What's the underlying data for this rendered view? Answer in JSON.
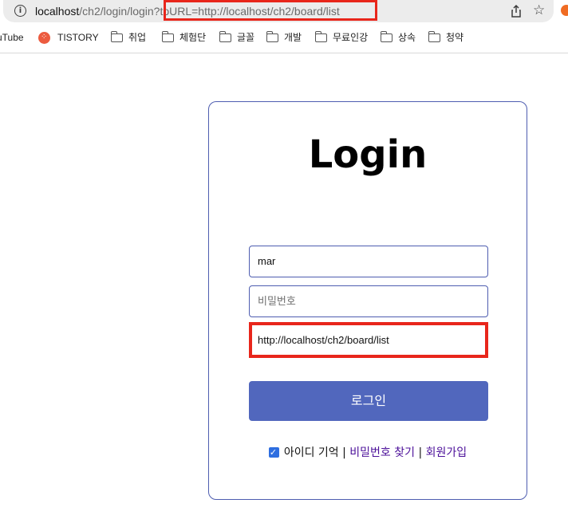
{
  "browser": {
    "url_host": "localhost",
    "url_path": "/ch2/login/login?toURL=http://localhost/ch2/board/list",
    "info_icon": "i",
    "star_icon": "☆"
  },
  "bookmarks": [
    {
      "label": "uTube",
      "icon": "none"
    },
    {
      "label": "TISTORY",
      "icon": "tistory-icon"
    },
    {
      "label": "취업",
      "icon": "folder-icon"
    },
    {
      "label": "체험단",
      "icon": "folder-icon"
    },
    {
      "label": "글꼴",
      "icon": "folder-icon"
    },
    {
      "label": "개발",
      "icon": "folder-icon"
    },
    {
      "label": "무료인강",
      "icon": "folder-icon"
    },
    {
      "label": "상속",
      "icon": "folder-icon"
    },
    {
      "label": "청약",
      "icon": "folder-icon"
    }
  ],
  "login": {
    "title": "Login",
    "id_value": "mar",
    "password_placeholder": "비밀번호",
    "to_url_value": "http://localhost/ch2/board/list",
    "button_label": "로그인",
    "remember_label": "아이디 기억",
    "separator": "|",
    "find_password": "비밀번호 찾기",
    "signup": "회원가입"
  },
  "colors": {
    "accent": "#5167bd",
    "highlight": "#e8261b",
    "link": "#4b0f99"
  }
}
